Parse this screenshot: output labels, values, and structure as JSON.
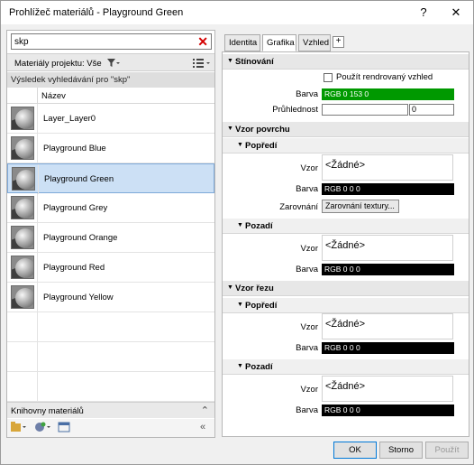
{
  "window": {
    "title": "Prohlížeč materiálů - Playground Green",
    "help_label": "?",
    "close_label": "✕"
  },
  "search": {
    "value": "skp",
    "clear_label": "✕"
  },
  "project_bar": {
    "label": "Materiály projektu: Vše",
    "filter_icon": "filter-icon",
    "view_icon": "list-view-icon"
  },
  "results": {
    "label": "Výsledek vyhledávání pro \"skp\""
  },
  "list": {
    "column_name": "Název",
    "items": [
      {
        "label": "Layer_Layer0"
      },
      {
        "label": "Playground Blue"
      },
      {
        "label": "Playground Green",
        "selected": true
      },
      {
        "label": "Playground Grey"
      },
      {
        "label": "Playground Orange"
      },
      {
        "label": "Playground Red"
      },
      {
        "label": "Playground Yellow"
      },
      {
        "label": ""
      },
      {
        "label": ""
      },
      {
        "label": ""
      }
    ]
  },
  "library": {
    "label": "Knihovny materiálů"
  },
  "tabs": [
    {
      "label": "Identita"
    },
    {
      "label": "Grafika"
    },
    {
      "label": "Vzhled"
    },
    {
      "label": "+"
    }
  ],
  "shading": {
    "title": "Stínování",
    "use_render_label": "Použít rendrovaný vzhled",
    "color_label": "Barva",
    "color_value": "RGB 0 153 0",
    "color_hex": "#009900",
    "transparency_label": "Průhlednost",
    "transparency_value": "0"
  },
  "surface_pattern": {
    "title": "Vzor povrchu",
    "foreground": {
      "title": "Popředí",
      "pattern_label": "Vzor",
      "pattern_value": "<Žádné>",
      "color_label": "Barva",
      "color_value": "RGB 0 0 0",
      "align_label": "Zarovnání",
      "align_button": "Zarovnání textury..."
    },
    "background": {
      "title": "Pozadí",
      "pattern_label": "Vzor",
      "pattern_value": "<Žádné>",
      "color_label": "Barva",
      "color_value": "RGB 0 0 0"
    }
  },
  "cut_pattern": {
    "title": "Vzor řezu",
    "foreground": {
      "title": "Popředí",
      "pattern_label": "Vzor",
      "pattern_value": "<Žádné>",
      "color_label": "Barva",
      "color_value": "RGB 0 0 0"
    },
    "background": {
      "title": "Pozadí",
      "pattern_label": "Vzor",
      "pattern_value": "<Žádné>",
      "color_label": "Barva",
      "color_value": "RGB 0 0 0"
    }
  },
  "buttons": {
    "ok": "OK",
    "cancel": "Storno",
    "apply": "Použít"
  }
}
